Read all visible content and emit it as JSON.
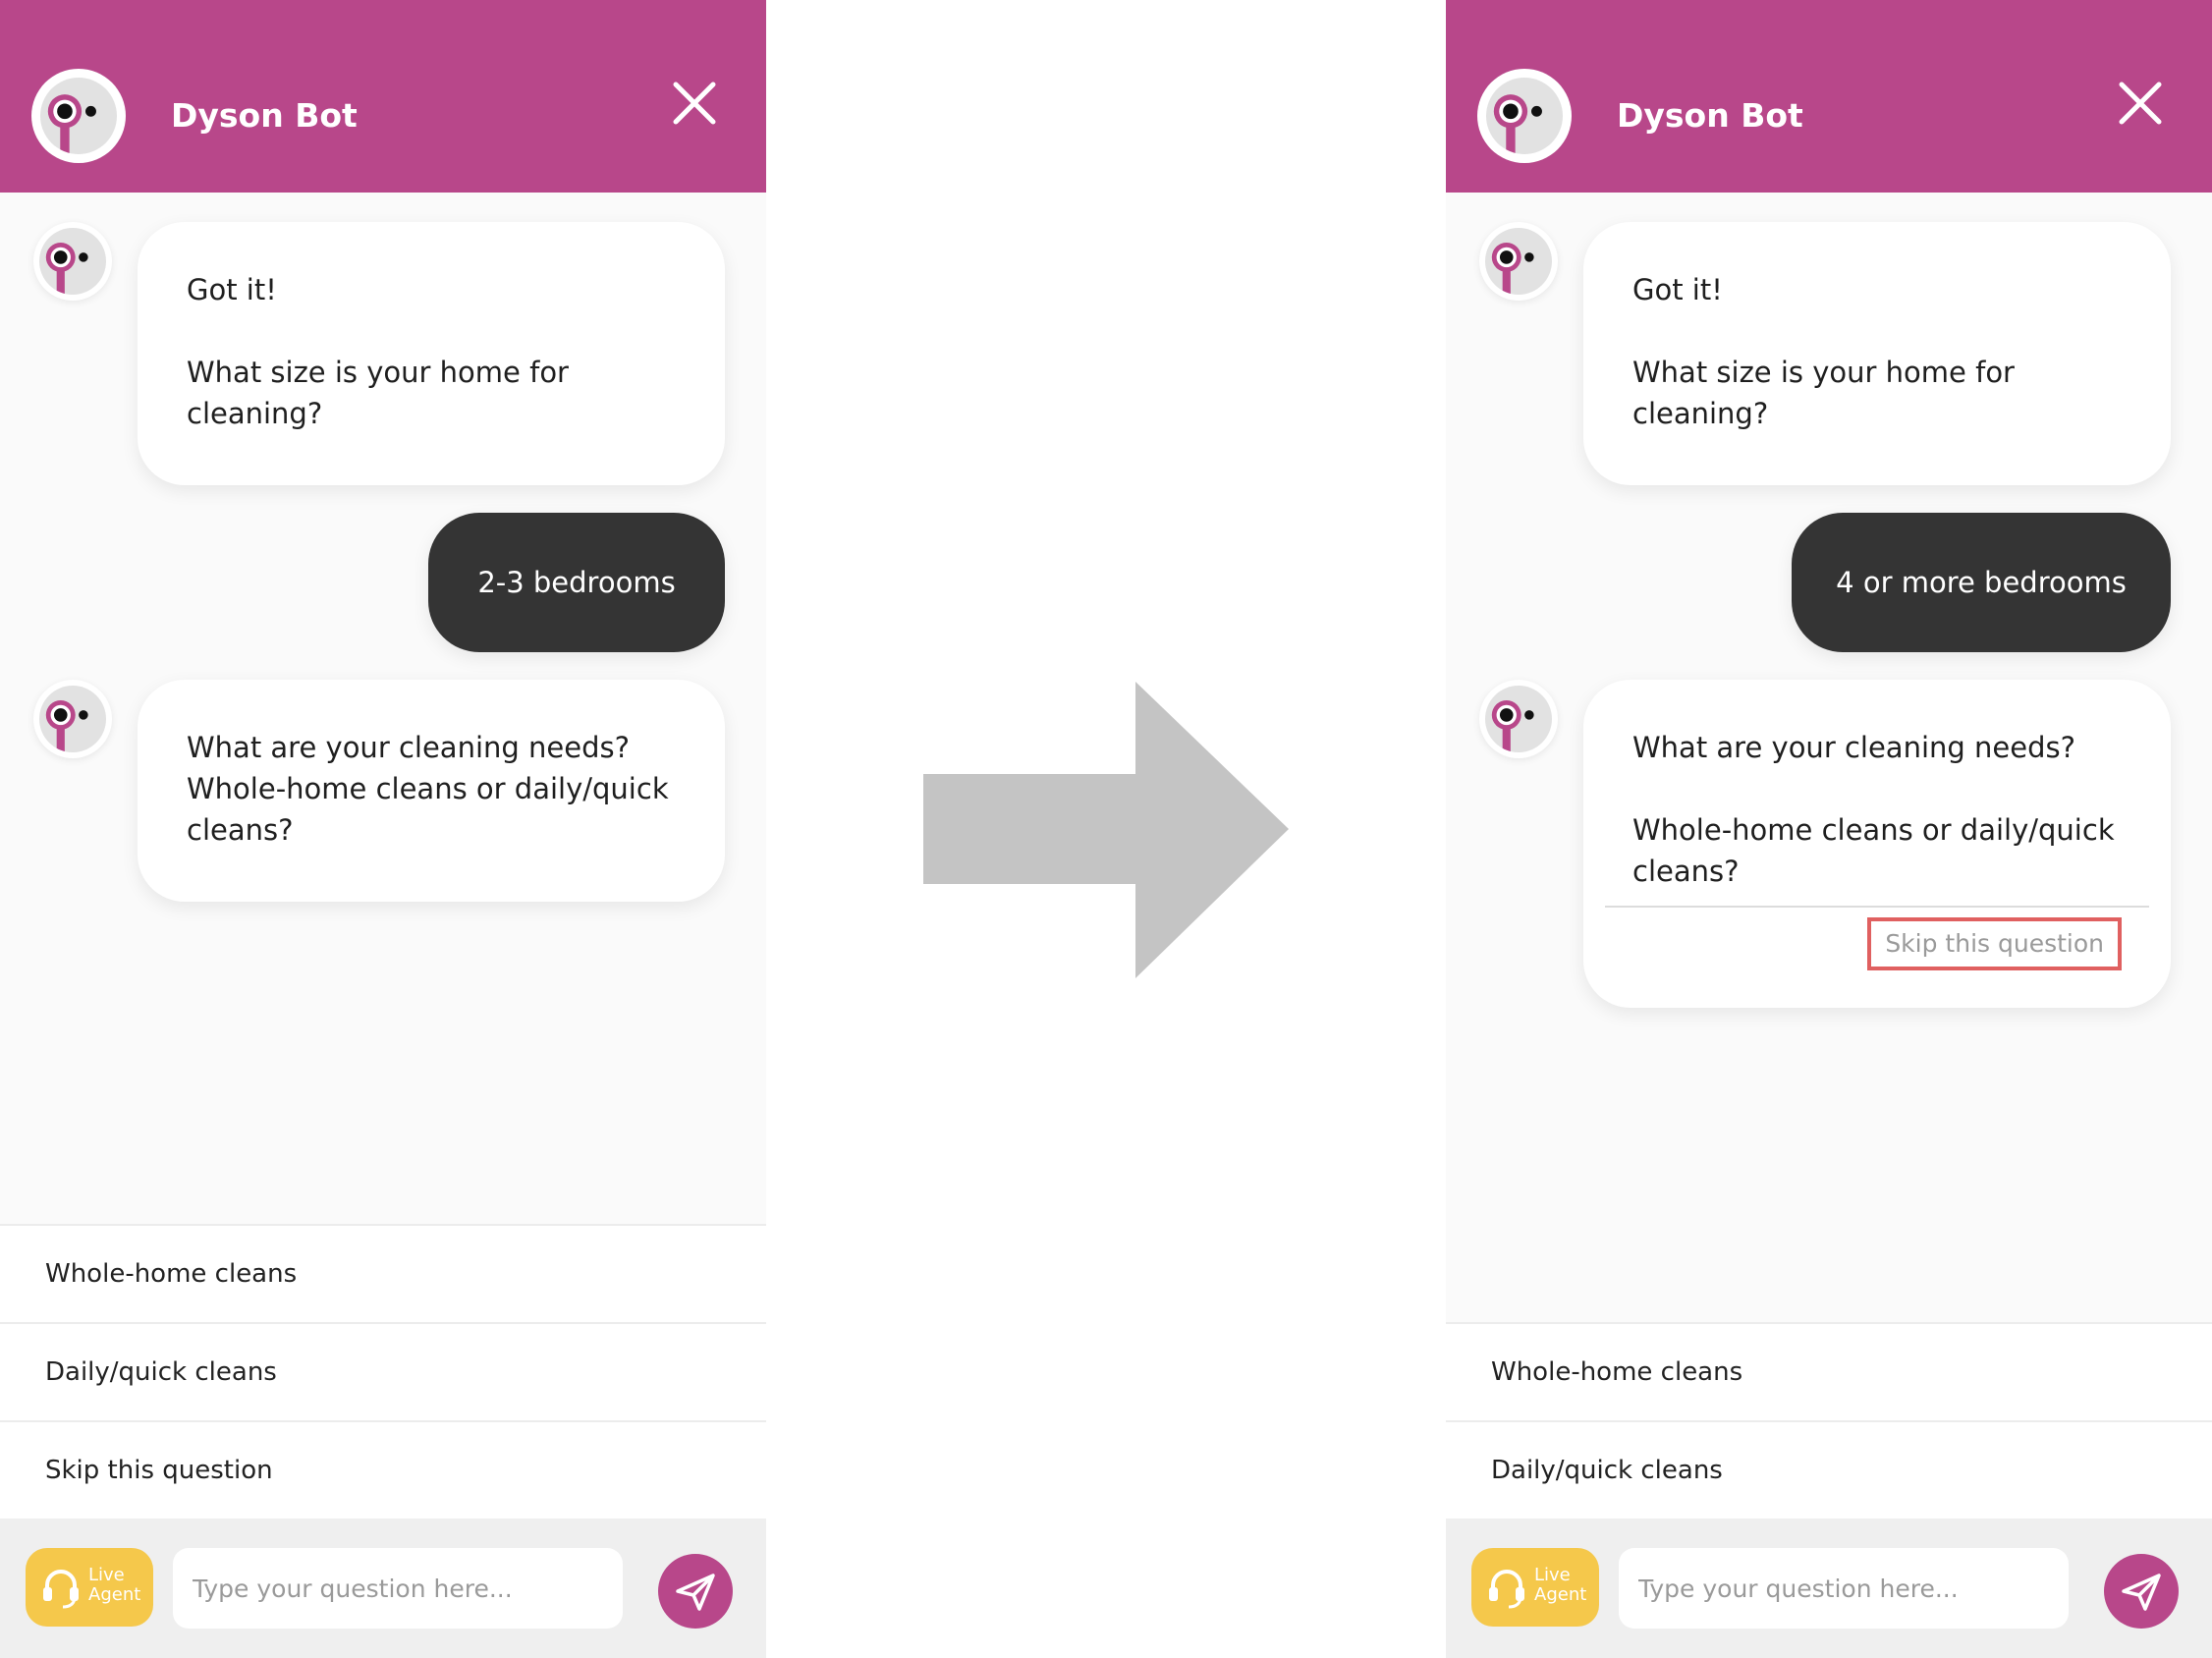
{
  "colors": {
    "brand": "#b8478a",
    "user_bubble": "#343434",
    "live_agent": "#f5c84b",
    "arrow": "#c4c4c4",
    "highlight": "#e06060"
  },
  "left": {
    "header": {
      "title": "Dyson Bot"
    },
    "messages": {
      "bot1_line1": "Got it!",
      "bot1_line2": "What size is your home for",
      "bot1_line3": "cleaning?",
      "user_reply": "2-3 bedrooms",
      "bot2_line1": "What are your cleaning needs?",
      "bot2_line2": "Whole-home cleans or daily/quick",
      "bot2_line3": "cleans?"
    },
    "options": [
      "Whole-home cleans",
      "Daily/quick cleans",
      "Skip this question"
    ],
    "footer": {
      "live_line1": "Live",
      "live_line2": "Agent",
      "placeholder": "Type your question here..."
    }
  },
  "right": {
    "header": {
      "title": "Dyson Bot"
    },
    "messages": {
      "bot1_line1": "Got it!",
      "bot1_line2": "What size is your home for",
      "bot1_line3": "cleaning?",
      "user_reply": "4 or more bedrooms",
      "bot2_line1": "What are your cleaning needs?",
      "bot2_line2": "Whole-home cleans or daily/quick",
      "bot2_line3": "cleans?",
      "skip_link": "Skip this question"
    },
    "options": [
      "Whole-home cleans",
      "Daily/quick cleans"
    ],
    "footer": {
      "live_line1": "Live",
      "live_line2": "Agent",
      "placeholder": "Type your question here..."
    }
  },
  "icons": {
    "logo": "bot-face-icon",
    "close": "close-icon",
    "headset": "headset-icon",
    "send": "send-icon",
    "arrow": "right-arrow-icon"
  }
}
